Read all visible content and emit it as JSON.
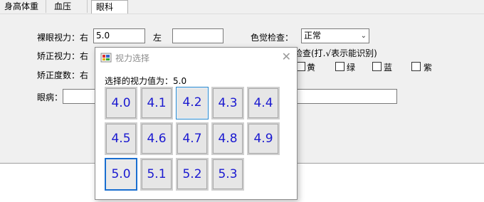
{
  "tabs": [
    "身高体重",
    "血压",
    "眼科"
  ],
  "selected_tab": "眼科",
  "form": {
    "naked_vision_label": "裸眼视力：右",
    "naked_vision_right_value": "5.0",
    "left_label": "左",
    "left_value": "",
    "corrected_vision_label": "矫正视力：右",
    "corrected_degree_label": "矫正度数：右",
    "color_check_label": "色觉检查：",
    "color_check_value": "正常",
    "color_test_label": "检查(打.√表示能识别)",
    "colors": [
      "黄",
      "绿",
      "蓝",
      "紫"
    ],
    "eye_disease_label": "眼病："
  },
  "dialog": {
    "title": "视力选择",
    "prompt": "选择的视力值为：5.0",
    "values": [
      "4.0",
      "4.1",
      "4.2",
      "4.3",
      "4.4",
      "4.5",
      "4.6",
      "4.7",
      "4.8",
      "4.9",
      "5.0",
      "5.1",
      "5.2",
      "5.3"
    ],
    "selected": "5.0"
  },
  "colors": {
    "value_text": "#1a19d0",
    "focus_border": "#1a6fd0"
  }
}
